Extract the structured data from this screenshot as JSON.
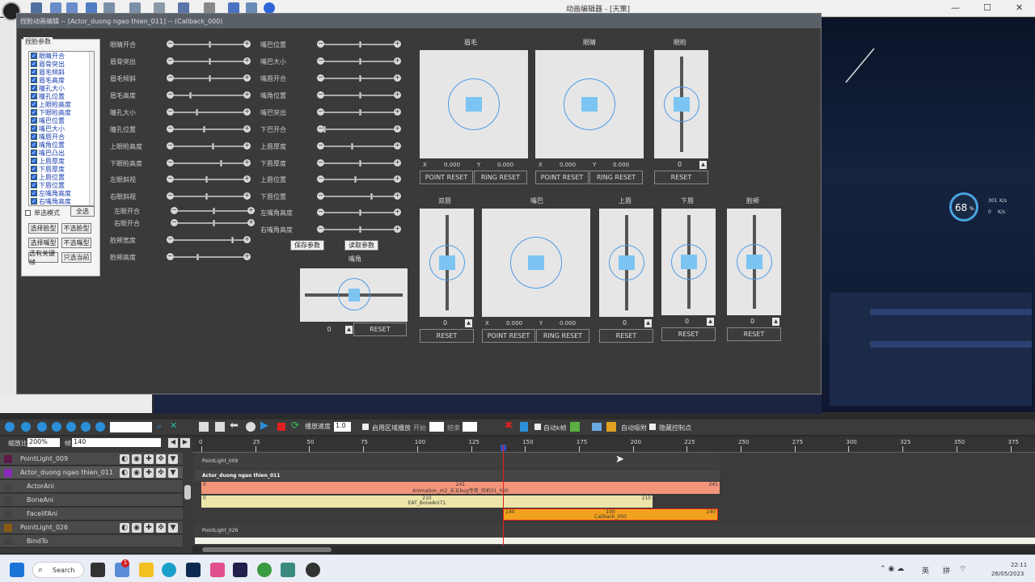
{
  "window": {
    "title": "动画编辑器 - [天策]",
    "min": "—",
    "max": "☐",
    "close": "✕"
  },
  "dialog": {
    "title": "捏脸动画编辑 -- [Actor_duong ngao thien_011] -- (Callback_000)",
    "group_title": "捏脸参数",
    "checklist": [
      "眼睛开合",
      "眉骨突出",
      "眉毛倾斜",
      "眉毛高度",
      "瞳孔大小",
      "瞳孔位置",
      "上眼睑高度",
      "下眼睑高度",
      "嘴巴位置",
      "嘴巴大小",
      "嘴唇开合",
      "嘴角位置",
      "嘴巴凸出",
      "上唇厚度",
      "下唇厚度",
      "上唇位置",
      "下唇位置",
      "左嘴角高度",
      "右嘴角高度"
    ],
    "single_mode": "单选模式",
    "select_all": "全选",
    "buttons": [
      "选择脸型",
      "不选脸型",
      "选择嘴型",
      "不选嘴型",
      "选有关键帧",
      "只选当前"
    ],
    "sliders_col1": [
      "眼睛开合",
      "眉骨突出",
      "眉毛倾斜",
      "眉毛高度",
      "瞳孔大小",
      "瞳孔位置",
      "上眼睑高度",
      "下眼睑高度",
      "左眼斜视",
      "右眼斜视",
      "左眼开合",
      "右眼开合",
      "脸颊宽度",
      "脸颊高度"
    ],
    "sliders_col2": [
      "嘴巴位置",
      "嘴巴大小",
      "嘴唇开合",
      "嘴角位置",
      "嘴巴突出",
      "下巴开合",
      "上唇厚度",
      "下唇厚度",
      "上唇位置",
      "下唇位置",
      "左嘴角高度",
      "右嘴角高度"
    ],
    "save_params": "保存参数",
    "load_params": "读取参数",
    "mouth_corner_label": "嘴角",
    "mouth_corner_value": "0",
    "reset": "RESET",
    "pads": {
      "brow": "眉毛",
      "eye": "眼睛",
      "eyelid": "眼睑",
      "cheek": "双唇",
      "mouth": "嘴巴",
      "upper_lip": "上唇",
      "lower_lip": "下唇",
      "jaw": "脸颊"
    },
    "x_label": "X",
    "y_label": "Y",
    "zero3": "0.000",
    "zero": "0",
    "point_reset": "POINT RESET",
    "ring_reset": "RING RESET"
  },
  "timeline": {
    "zoom_label": "缩放比",
    "zoom": "200%",
    "frame_label": "帧",
    "frame": "140",
    "speed_label": "播放速度",
    "speed": "1.0",
    "range_play": "启用区域播放",
    "start": "开始",
    "end": "结束",
    "auto_key": "自动k帧",
    "auto_snap": "自动吸附",
    "hide_ctrl": "隐藏控制点",
    "ruler": [
      "0",
      "25",
      "50",
      "75",
      "100",
      "125",
      "150",
      "175",
      "200",
      "225",
      "250",
      "275",
      "300",
      "325",
      "350",
      "375"
    ],
    "tracks": [
      "PointLight_009",
      "Actor_duong ngao thien_011",
      "ActorAni",
      "BoneAni",
      "FacelifAni",
      "PointLight_026",
      "BindTo"
    ],
    "row_labels": [
      "PointLight_009",
      "Actor_duong ngao thien_011",
      "PointLight_026"
    ],
    "clips": [
      {
        "name": "Animation_m2_五五bug专用_待机01_000",
        "start": "0",
        "mid": "241",
        "end": "241",
        "color": "#f2957a"
      },
      {
        "name": "EAT_BoneAni71",
        "start": "0",
        "mid": "210",
        "end": "210",
        "color": "#ede6a8"
      },
      {
        "name": "Callback_000",
        "start": "140",
        "mid": "100",
        "end": "240",
        "color": "#f2a21e"
      }
    ]
  },
  "hud": {
    "percent": "68",
    "unit": "%",
    "up": "301",
    "down": "0",
    "rate": "K/s"
  },
  "taskbar": {
    "search": "Search",
    "lang": "英",
    "ime": "拼",
    "time": "22:11",
    "date": "26/05/2023",
    "badge": "1"
  }
}
